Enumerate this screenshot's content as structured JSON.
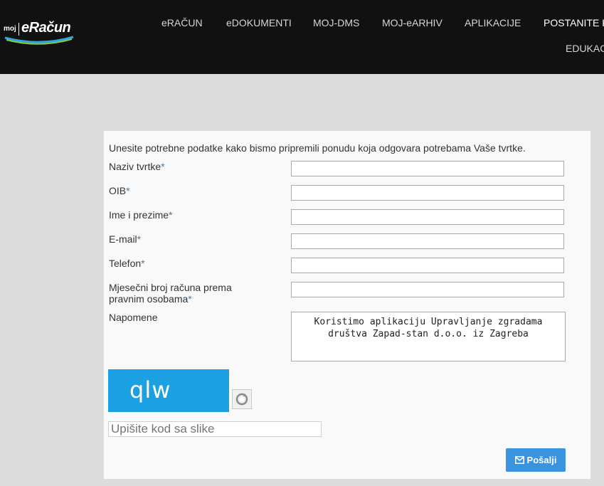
{
  "header": {
    "logo": {
      "prefix": "moj",
      "brand": "eRačun"
    },
    "nav": [
      {
        "label": "eRAČUN"
      },
      {
        "label": "eDOKUMENTI"
      },
      {
        "label": "MOJ-DMS"
      },
      {
        "label": "MOJ-eARHIV"
      },
      {
        "label": "APLIKACIJE"
      },
      {
        "label": "POSTANITE K",
        "active": true
      },
      {
        "label": "EDUKAC"
      }
    ]
  },
  "form": {
    "intro": "Unesite potrebne podatke kako bismo pripremili ponudu koja odgovara potrebama Vaše tvrtke.",
    "required_mark": "*",
    "fields": [
      {
        "label": "Naziv tvrtke",
        "required": true,
        "value": ""
      },
      {
        "label": "OIB",
        "required": true,
        "value": ""
      },
      {
        "label": "Ime i prezime",
        "required": true,
        "value": ""
      },
      {
        "label": "E-mail",
        "required": true,
        "value": ""
      },
      {
        "label": "Telefon",
        "required": true,
        "value": ""
      },
      {
        "label_line1": "Mjesečni broj računa prema",
        "label_line2": "pravnim osobama",
        "required": true,
        "value": ""
      }
    ],
    "notes": {
      "label": "Napomene",
      "line1": "Koristimo aplikaciju Upravljanje zgradama",
      "line2": "društva Zapad-stan d.o.o. iz Zagreba"
    },
    "captcha": {
      "text": "qlw",
      "refresh_icon": "refresh-icon",
      "placeholder": "Upišite kod sa slike"
    },
    "submit": {
      "label": "Pošalji",
      "icon": "envelope-icon"
    }
  },
  "colors": {
    "header_bg": "#111111",
    "page_bg": "#dcdcdc",
    "panel_bg": "#f9f9f9",
    "required": "#2f7fc9",
    "captcha_bg": "#1ba0e1",
    "button_bg": "#3a93df"
  }
}
